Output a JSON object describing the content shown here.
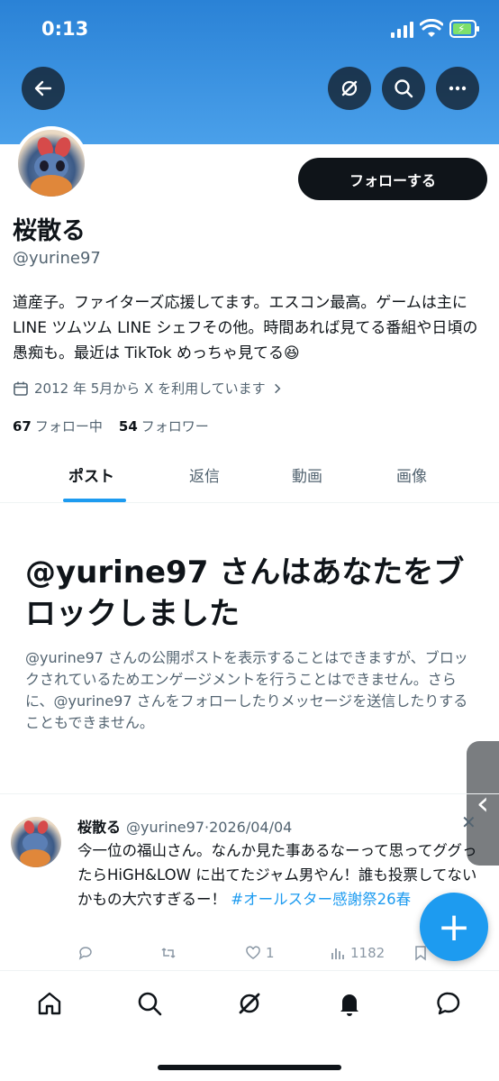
{
  "status_bar": {
    "time": "0:13"
  },
  "colors": {
    "accent": "#1d9bf0",
    "banner": "#3a93e2",
    "text": "#0f1419",
    "muted": "#536471"
  },
  "header": {
    "back_icon": "arrow-left-icon",
    "grok_icon": "grok-icon",
    "search_icon": "search-icon",
    "more_icon": "more-icon"
  },
  "profile": {
    "name": "桜散る",
    "handle": "@yurine97",
    "follow_label": "フォローする",
    "bio_prefix": "道産子。ファイターズ応援してます。エスコン最高。ゲームは主に LINE ツムツム LINE シェフその他。時間あれば見てる番組や日頃の愚痴も。最近は TikTok めっちゃ見てる",
    "bio_emoji": "😆",
    "joined": "2012 年 5月から X を利用しています",
    "following_count": "67",
    "following_label": "フォロー中",
    "followers_count": "54",
    "followers_label": "フォロワー"
  },
  "tabs": [
    {
      "label": "ポスト",
      "active": true
    },
    {
      "label": "返信",
      "active": false
    },
    {
      "label": "動画",
      "active": false
    },
    {
      "label": "画像",
      "active": false
    }
  ],
  "blocked": {
    "title": "@yurine97 さんはあなたをブロックしました",
    "text": "@yurine97 さんの公開ポストを表示することはできますが、ブロックされているためエンゲージメントを行うことはできません。さらに、@yurine97 さんをフォローしたりメッセージを送信したりすることもできません。"
  },
  "post": {
    "name": "桜散る",
    "handle": "@yurine97",
    "separator": "·",
    "date": "2026/04/04",
    "text_line": "今一位の福山さん。なんか見た事あるなーって思ってググったらHiGH&LOW に出てたジャム男やん！誰も投票してないかもの大穴すぎるー！ ",
    "hashtag": "#オールスター感謝祭26春",
    "likes": "1",
    "views": "1182"
  },
  "fab_label": "+",
  "bottom_nav": [
    "home-icon",
    "search-icon",
    "grok-icon",
    "notifications-icon",
    "messages-icon"
  ]
}
